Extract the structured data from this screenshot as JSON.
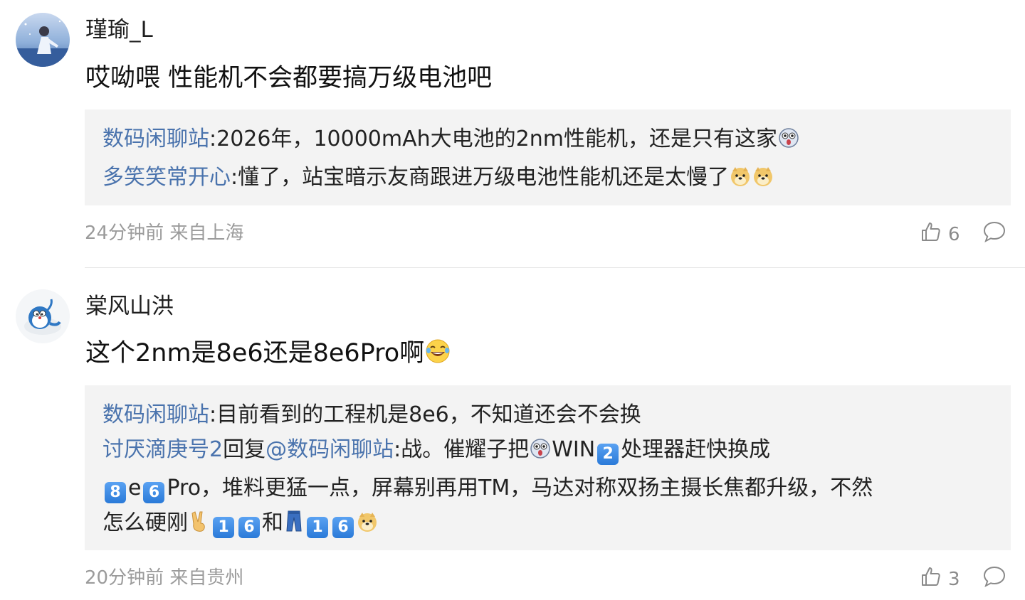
{
  "comments": [
    {
      "username": "瑾瑜_L",
      "text": "哎呦喂 性能机不会都要搞万级电池吧",
      "replies": [
        {
          "name": "数码闲聊站",
          "text": ":2026年，10000mAh大电池的2nm性能机，还是只有这家"
        },
        {
          "name": "多笑笑常开心",
          "text": ":懂了，站宝暗示友商跟进万级电池性能机还是太慢了"
        }
      ],
      "meta": "24分钟前 来自上海",
      "likes": "6"
    },
    {
      "username": "棠风山洪",
      "text": "这个2nm是8e6还是8e6Pro啊",
      "replies": [
        {
          "name": "数码闲聊站",
          "text": ":目前看到的工程机是8e6，不知道还会不会换"
        },
        {
          "name": "讨厌滴庚号2",
          "mid": "回复",
          "name2": "@数码闲聊站",
          "text": ":战。催耀子把",
          "text_b": "WIN",
          "text_c": "处理器赶快换成"
        },
        {
          "text_a": "e",
          "text_b": "Pro，堆料更猛一点，屏幕别再用TM，马达对称双扬主摄长焦都升级，不然"
        },
        {
          "text_a": "怎么硬刚",
          "text_b": "和"
        }
      ],
      "meta": "20分钟前 来自贵州",
      "likes": "3"
    }
  ],
  "keycaps": {
    "k1": "1",
    "k2": "2",
    "k6": "6",
    "k8": "8"
  },
  "colors": {
    "link": "#4a73ad",
    "reply_bg": "#f3f3f3",
    "meta": "#9b9b9b"
  }
}
